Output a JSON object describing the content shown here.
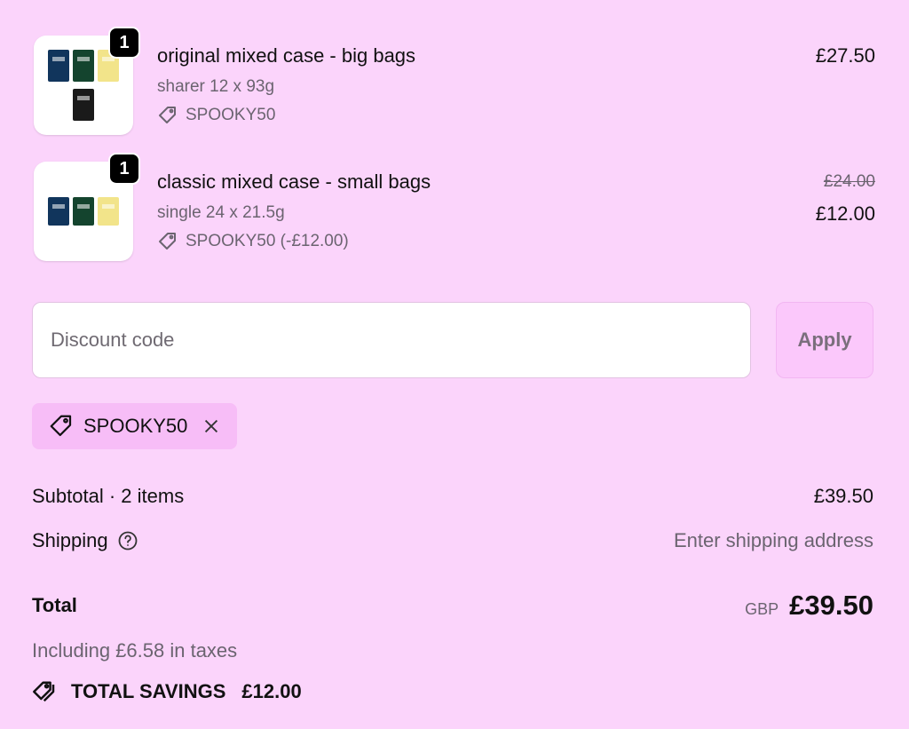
{
  "items": [
    {
      "quantity": "1",
      "title": "original mixed case - big bags",
      "variant": "sharer 12 x 93g",
      "discount": "SPOOKY50",
      "price": "£27.50"
    },
    {
      "quantity": "1",
      "title": "classic mixed case - small bags",
      "variant": "single 24 x 21.5g",
      "discount": "SPOOKY50 (-£12.00)",
      "original_price": "£24.00",
      "price": "£12.00"
    }
  ],
  "discount": {
    "placeholder": "Discount code",
    "apply_label": "Apply",
    "applied_code": "SPOOKY50"
  },
  "summary": {
    "subtotal_label": "Subtotal · 2 items",
    "subtotal_value": "£39.50",
    "shipping_label": "Shipping",
    "shipping_value": "Enter shipping address",
    "total_label": "Total",
    "currency": "GBP",
    "total_value": "£39.50",
    "taxes": "Including £6.58 in taxes",
    "savings_label": "TOTAL SAVINGS",
    "savings_value": "£12.00"
  },
  "colors": {
    "background": "#fbd4fb",
    "apply_button": "#fbc8fb",
    "chip": "#f7bdf7"
  },
  "icons": [
    "tag-icon",
    "close-icon",
    "help-circle-icon",
    "tags-icon"
  ]
}
